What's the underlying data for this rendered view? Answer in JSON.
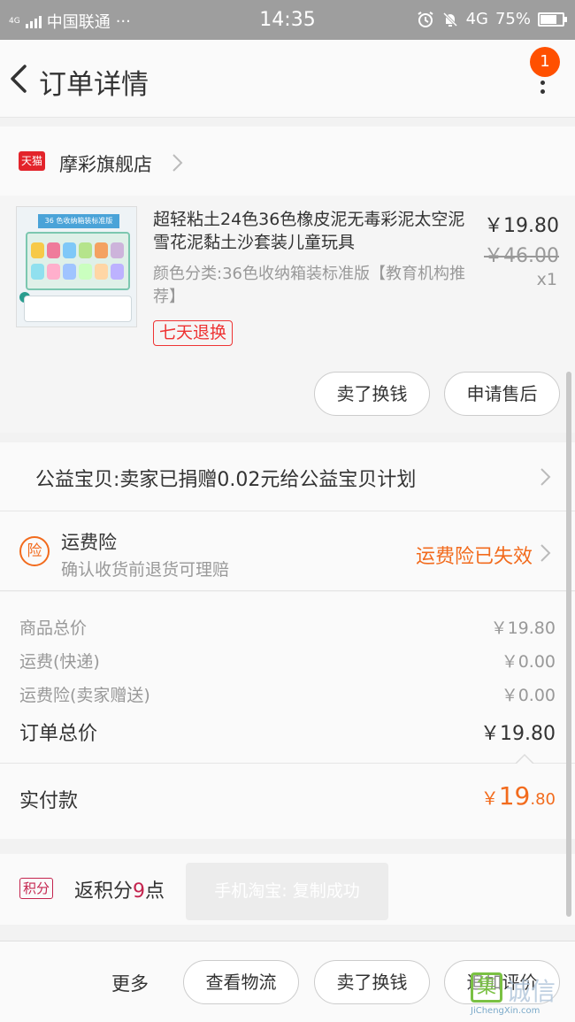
{
  "status_bar": {
    "network_small": "4G",
    "carrier": "中国联通",
    "dots": "···",
    "time": "14:35",
    "network": "4G",
    "battery": "75%",
    "battery_level": 0.75
  },
  "header": {
    "title": "订单详情",
    "badge_count": "1"
  },
  "store": {
    "badge": "天猫",
    "name": "摩彩旗舰店"
  },
  "product": {
    "image_label": "36 色收纳箱装标准版",
    "title": "超轻粘土24色36色橡皮泥无毒彩泥太空泥雪花泥黏土沙套装儿童玩具",
    "sku": "颜色分类:36色收纳箱装标准版【教育机构推荐】",
    "tag": "七天退换",
    "price": "￥19.80",
    "original_price": "￥46.00",
    "quantity": "x1",
    "buttons": {
      "sell": "卖了换钱",
      "after_sale": "申请售后"
    }
  },
  "charity": {
    "text": "公益宝贝:卖家已捐赠0.02元给公益宝贝计划"
  },
  "insurance": {
    "icon": "险",
    "name": "运费险",
    "desc": "确认收货前退货可理赔",
    "status": "运费险已失效",
    "status_color": "#f26b1d"
  },
  "totals": {
    "rows": [
      {
        "label": "商品总价",
        "value": "￥19.80"
      },
      {
        "label": "运费(快递)",
        "value": "￥0.00"
      },
      {
        "label": "运费险(卖家赠送)",
        "value": "￥0.00"
      }
    ],
    "order_total_label": "订单总价",
    "order_total_value": "￥19.80"
  },
  "paid": {
    "label": "实付款",
    "currency": "￥",
    "integer": "19",
    "decimal": ".80"
  },
  "points": {
    "tag": "积分",
    "prefix": "返积分",
    "count": "9",
    "suffix": "点",
    "toast": "手机淘宝: 复制成功"
  },
  "bottom_bar": {
    "more": "更多",
    "logistics": "查看物流",
    "sell": "卖了换钱",
    "review": "追加评价"
  },
  "watermark": {
    "mark": "集",
    "text": "诚信",
    "url": "JiChengXin.com"
  },
  "colors": {
    "accent": "#f26b1d",
    "badge": "#ff5000",
    "tmall": "#e3242b",
    "points": "#c4244e"
  }
}
